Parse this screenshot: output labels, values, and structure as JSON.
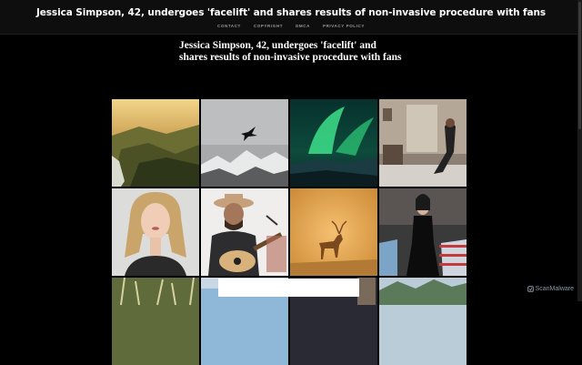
{
  "site": {
    "title": "Jessica Simpson, 42, undergoes 'facelift' and shares results of non-invasive procedure with fans"
  },
  "nav": {
    "items": [
      {
        "label": "CONTACT"
      },
      {
        "label": "COPYRIGHT"
      },
      {
        "label": "DMCA"
      },
      {
        "label": "PRIVACY POLICY"
      }
    ]
  },
  "article": {
    "title": "Jessica Simpson, 42, undergoes 'facelift' and shares results of non-invasive procedure with fans"
  },
  "gallery": {
    "tiles": [
      {
        "name": "photo-waterfall-valley"
      },
      {
        "name": "photo-eagle-mountains"
      },
      {
        "name": "photo-aurora"
      },
      {
        "name": "photo-room-interior"
      },
      {
        "name": "photo-blonde-woman"
      },
      {
        "name": "photo-cowboy-guitar"
      },
      {
        "name": "photo-deer-fog"
      },
      {
        "name": "photo-gala-dress"
      },
      {
        "name": "photo-grass"
      },
      {
        "name": "photo-sky"
      },
      {
        "name": "photo-people"
      },
      {
        "name": "photo-mountain-lake"
      }
    ]
  },
  "watermark": {
    "text": "ScanMalware"
  },
  "colors": {
    "background": "#000000",
    "header": "#0e0e0e",
    "text": "#ffffff",
    "nav_text": "#9a9a9a"
  }
}
